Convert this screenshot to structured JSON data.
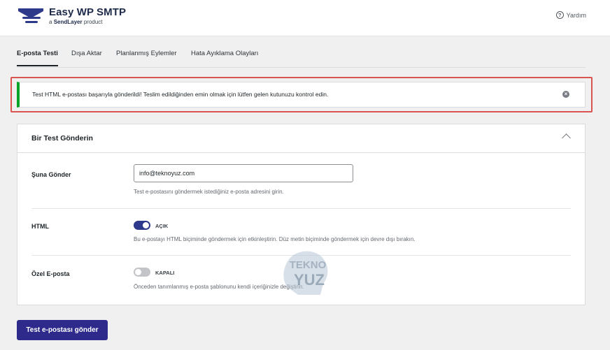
{
  "brand": {
    "name": "Easy WP SMTP",
    "sub_prefix": "a",
    "sub_company": "SendLayer",
    "sub_suffix": "product"
  },
  "header": {
    "help_icon": "question-circle-icon",
    "help_label": "Yardım"
  },
  "tabs": [
    {
      "label": "E-posta Testi",
      "active": true
    },
    {
      "label": "Dışa Aktar",
      "active": false
    },
    {
      "label": "Planlanmış Eylemler",
      "active": false
    },
    {
      "label": "Hata Ayıklama Olayları",
      "active": false
    }
  ],
  "notice": {
    "text": "Test HTML e-postası başarıyla gönderildi! Teslim edildiğinden emin olmak için lütfen gelen kutunuzu kontrol edin.",
    "close_icon": "close-circle-icon",
    "accent_color": "#00a32a",
    "highlight_color": "#d9534f"
  },
  "panel": {
    "title": "Bir Test Gönderin",
    "collapse_icon": "chevron-up-icon",
    "send_to": {
      "label": "Şuna Gönder",
      "value": "info@teknoyuz.com",
      "description": "Test e-postasını göndermek istediğiniz e-posta adresini girin."
    },
    "html": {
      "label": "HTML",
      "toggle_state": "AÇIK",
      "enabled": true,
      "description": "Bu e-postayı HTML biçiminde göndermek için etkinleştirin. Düz metin biçiminde göndermek için devre dışı bırakın."
    },
    "custom_email": {
      "label": "Özel E-posta",
      "toggle_state": "KAPALI",
      "enabled": false,
      "description": "Önceden tanımlanmış e-posta şablonunu kendi içeriğinizle değiştirin."
    }
  },
  "watermark": {
    "line1": "TEKNO",
    "line2": "YUZ"
  },
  "footer": {
    "send_button": "Test e-postası gönder"
  },
  "colors": {
    "primary": "#2d2a8c",
    "toggle_on": "#2d3a8c",
    "toggle_off": "#c3c4c7"
  }
}
